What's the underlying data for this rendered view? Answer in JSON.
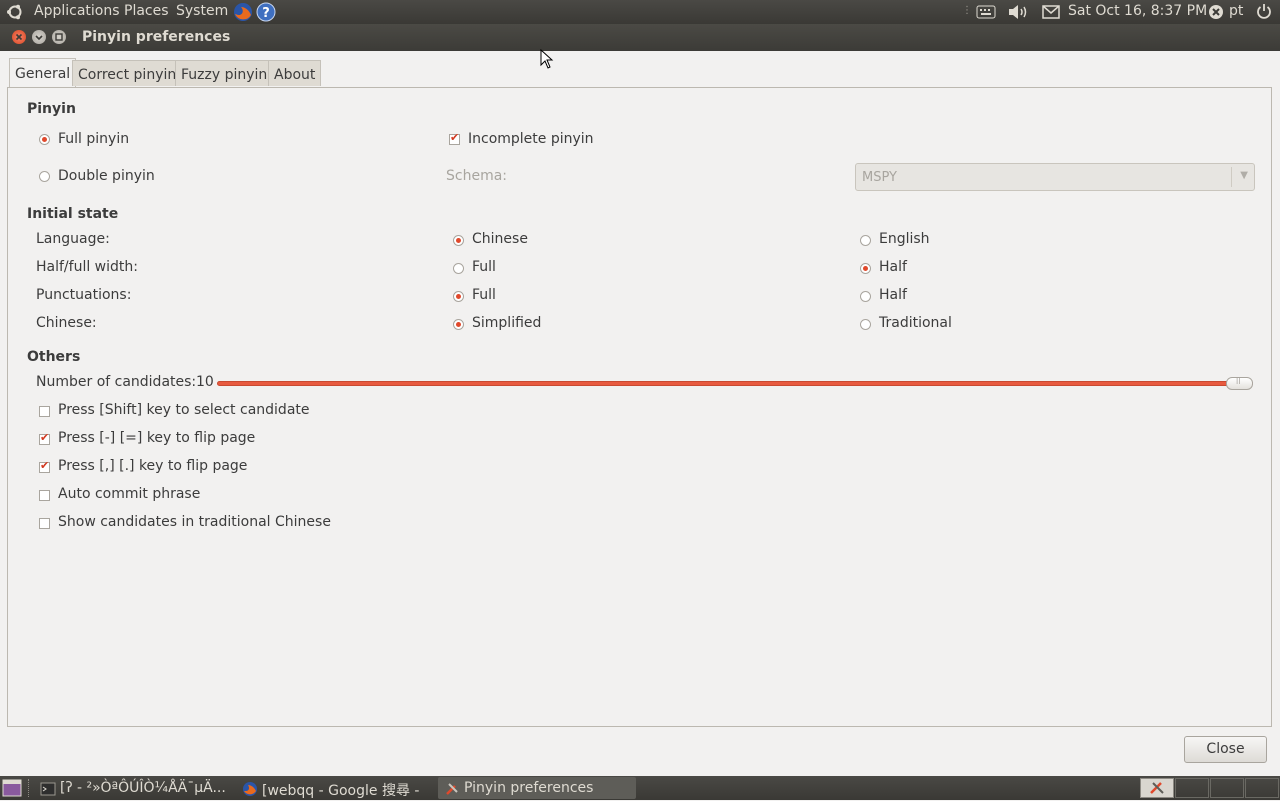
{
  "top_panel": {
    "menus": [
      "Applications",
      "Places",
      "System"
    ],
    "clock": "Sat Oct 16,  8:37 PM",
    "user": "pt"
  },
  "window": {
    "title": "Pinyin preferences"
  },
  "tabs": [
    "General",
    "Correct pinyin",
    "Fuzzy pinyin",
    "About"
  ],
  "active_tab": "General",
  "pinyin": {
    "heading": "Pinyin",
    "full_pinyin": "Full pinyin",
    "full_pinyin_selected": true,
    "double_pinyin": "Double pinyin",
    "double_pinyin_selected": false,
    "incomplete_pinyin": "Incomplete pinyin",
    "incomplete_pinyin_checked": true,
    "schema_label": "Schema:",
    "schema_value": "MSPY"
  },
  "initial_state": {
    "heading": "Initial state",
    "rows": [
      {
        "label": "Language:",
        "option_a": "Chinese",
        "option_b": "English",
        "selected": "a"
      },
      {
        "label": "Half/full width:",
        "option_a": "Full",
        "option_b": "Half",
        "selected": "b"
      },
      {
        "label": "Punctuations:",
        "option_a": "Full",
        "option_b": "Half",
        "selected": "a"
      },
      {
        "label": "Chinese:",
        "option_a": "Simplified",
        "option_b": "Traditional",
        "selected": "a"
      }
    ]
  },
  "others": {
    "heading": "Others",
    "candidates_label": "Number of candidates:",
    "candidates_value": "10",
    "slider_level": 1.0,
    "options": [
      {
        "label": "Press [Shift] key to select candidate",
        "checked": false
      },
      {
        "label": "Press [-] [=] key to flip page",
        "checked": true
      },
      {
        "label": "Press [,] [.] key to flip page",
        "checked": true
      },
      {
        "label": "Auto commit phrase",
        "checked": false
      },
      {
        "label": "Show candidates in traditional Chinese",
        "checked": false
      }
    ]
  },
  "buttons": {
    "close": "Close"
  },
  "taskbar": {
    "tasks": [
      {
        "label": "[ʔ - ²»ÒªÔÚÎÒ¼ÅÄ¯µÄ...",
        "active": false
      },
      {
        "label": "[webqq - Google 搜尋 - ...",
        "active": false
      },
      {
        "label": "Pinyin preferences",
        "active": true
      }
    ]
  },
  "colors": {
    "accent": "#e0492c",
    "panel": "#3c3b37",
    "window_bg": "#f2f1f0"
  }
}
